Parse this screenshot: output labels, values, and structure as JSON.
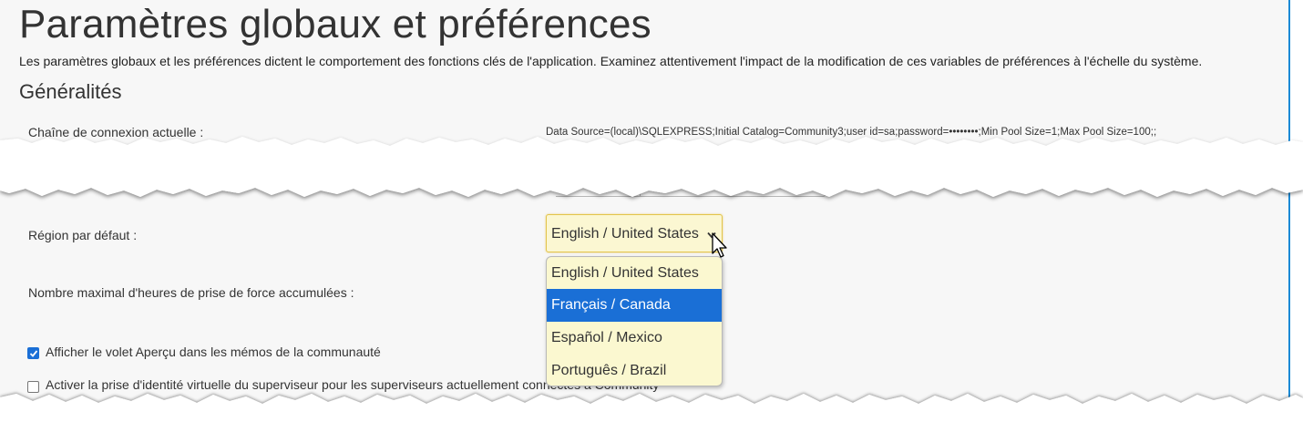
{
  "page": {
    "title": "Paramètres globaux et préférences",
    "description": "Les paramètres globaux et les préférences dictent le comportement des fonctions clés de l'application. Examinez attentivement l'impact de la modification de ces variables de préférences à l'échelle du système."
  },
  "section": {
    "title": "Généralités"
  },
  "fields": {
    "connection_label": "Chaîne de connexion actuelle :",
    "connection_value": "Data Source=(local)\\SQLEXPRESS;Initial Catalog=Community3;user id=sa;password=••••••••;Min Pool Size=1;Max Pool Size=100;;",
    "region_label": "Région par défaut :",
    "region_selected": "English / United States",
    "region_options": [
      "English / United States",
      "Français / Canada",
      "Español / Mexico",
      "Português / Brazil"
    ],
    "region_highlighted_index": 1,
    "max_hours_label": "Nombre maximal d'heures de prise de force accumulées :"
  },
  "checkboxes": [
    {
      "label": "Afficher le volet Aperçu dans les mémos de la communauté",
      "checked": true
    },
    {
      "label": "Activer la prise d'identité virtuelle du superviseur pour les superviseurs actuellement connectés à Community",
      "checked": false
    }
  ],
  "colors": {
    "accent": "#1a6fd6",
    "frame_border": "#1b8ad6",
    "select_bg": "#fbf7d2",
    "select_border": "#e3c44b"
  }
}
